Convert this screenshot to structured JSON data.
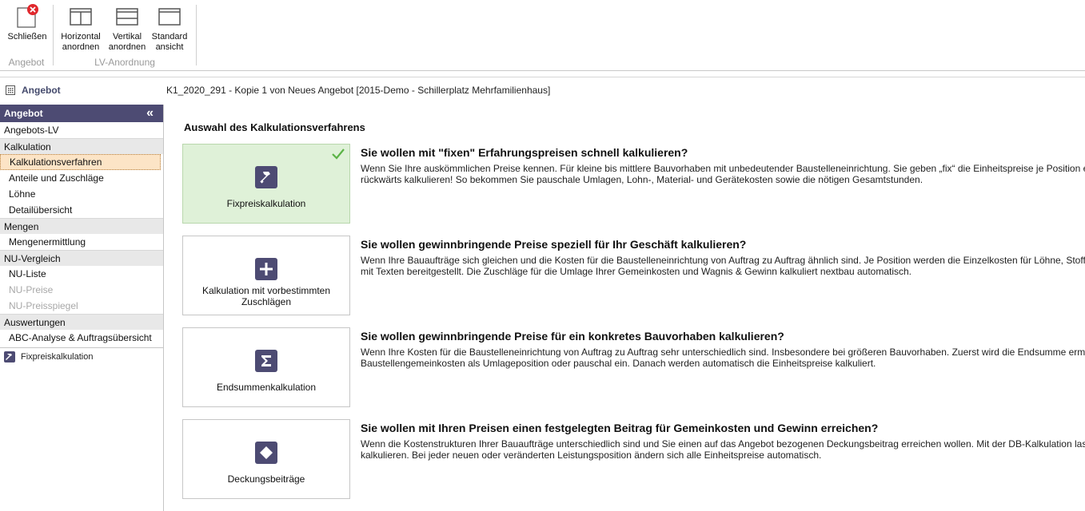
{
  "ribbon": {
    "groups": [
      {
        "label": "Angebot",
        "buttons": [
          {
            "label_line1": "Schließen",
            "label_line2": ""
          }
        ]
      },
      {
        "label": "LV-Anordnung",
        "buttons": [
          {
            "label_line1": "Horizontal",
            "label_line2": "anordnen"
          },
          {
            "label_line1": "Vertikal",
            "label_line2": "anordnen"
          },
          {
            "label_line1": "Standard",
            "label_line2": "ansicht"
          }
        ]
      }
    ]
  },
  "titlebar": {
    "section": "Angebot",
    "document": "K1_2020_291 - Kopie 1 von Neues Angebot [2015-Demo - Schillerplatz Mehrfamilienhaus]"
  },
  "sidebar": {
    "header": "Angebot",
    "collapse_glyph": "«",
    "items": [
      {
        "label": "Angebots-LV",
        "kind": "top"
      },
      {
        "label": "Kalkulation",
        "kind": "cat"
      },
      {
        "label": "Kalkulationsverfahren",
        "kind": "sub",
        "active": true
      },
      {
        "label": "Anteile und Zuschläge",
        "kind": "sub"
      },
      {
        "label": "Löhne",
        "kind": "sub"
      },
      {
        "label": "Detailübersicht",
        "kind": "sub"
      },
      {
        "label": "Mengen",
        "kind": "cat"
      },
      {
        "label": "Mengenermittlung",
        "kind": "sub"
      },
      {
        "label": "NU-Vergleich",
        "kind": "cat"
      },
      {
        "label": "NU-Liste",
        "kind": "sub"
      },
      {
        "label": "NU-Preise",
        "kind": "sub",
        "disabled": true
      },
      {
        "label": "NU-Preisspiegel",
        "kind": "sub",
        "disabled": true
      },
      {
        "label": "Auswertungen",
        "kind": "cat"
      },
      {
        "label": "ABC-Analyse & Auftragsübersicht",
        "kind": "sub"
      }
    ],
    "footer": "Fixpreiskalkulation"
  },
  "main": {
    "title": "Auswahl des Kalkulationsverfahrens",
    "options": [
      {
        "card_label": "Fixpreiskalkulation",
        "icon": "hammer-icon",
        "selected": true,
        "heading": "Sie wollen mit \"fixen\" Erfahrungspreisen schnell kalkulieren?",
        "desc_line1": "Wenn Sie Ihre auskömmlichen Preise kennen. Für kleine bis mittlere Bauvorhaben mit unbedeutender Baustelleneinrichtung. Sie geben „fix“ die Einheitspreise je Position e",
        "desc_line2": "rückwärts kalkulieren! So bekommen Sie pauschale Umlagen, Lohn-, Material- und Gerätekosten sowie die nötigen Gesamtstunden."
      },
      {
        "card_label": "Kalkulation mit vorbestimmten Zuschlägen",
        "icon": "plus-icon",
        "selected": false,
        "heading": "Sie wollen gewinnbringende Preise speziell für Ihr Geschäft kalkulieren?",
        "desc_line1": "Wenn Ihre Bauaufträge sich gleichen und die Kosten für die Baustelleneinrichtung von Auftrag zu Auftrag ähnlich sind. Je Position werden die Einzelkosten für Löhne, Stoff",
        "desc_line2": "mit Texten bereitgestellt. Die Zuschläge für die Umlage Ihrer Gemeinkosten und Wagnis & Gewinn kalkuliert nextbau automatisch."
      },
      {
        "card_label": "Endsummenkalkulation",
        "icon": "sigma-icon",
        "selected": false,
        "heading": "Sie wollen gewinnbringende Preise für ein konkretes Bauvorhaben kalkulieren?",
        "desc_line1": "Wenn Ihre Kosten für die Baustelleneinrichtung von Auftrag zu Auftrag sehr unterschiedlich sind. Insbesondere bei größeren Bauvorhaben. Zuerst wird die Endsumme erm",
        "desc_line2": "Baustellengemeinkosten als Umlageposition oder pauschal ein. Danach werden automatisch die Einheitspreise kalkuliert."
      },
      {
        "card_label": "Deckungsbeiträge",
        "icon": "diamond-icon",
        "selected": false,
        "heading": "Sie wollen mit Ihren Preisen einen festgelegten Beitrag für Gemeinkosten und Gewinn erreichen?",
        "desc_line1": "Wenn die Kostenstrukturen Ihrer Bauaufträge unterschiedlich sind und Sie einen auf das Angebot bezogenen Deckungsbeitrag erreichen wollen. Mit der DB-Kalkulation las",
        "desc_line2": "kalkulieren. Bei jeder neuen oder veränderten Leistungsposition ändern sich alle Einheitspreise automatisch."
      }
    ]
  },
  "colors": {
    "accent": "#4d4b73",
    "selected_card": "#dff1d8",
    "active_nav": "#fce4c6",
    "check": "#5bb346",
    "close_badge": "#e0282d"
  }
}
